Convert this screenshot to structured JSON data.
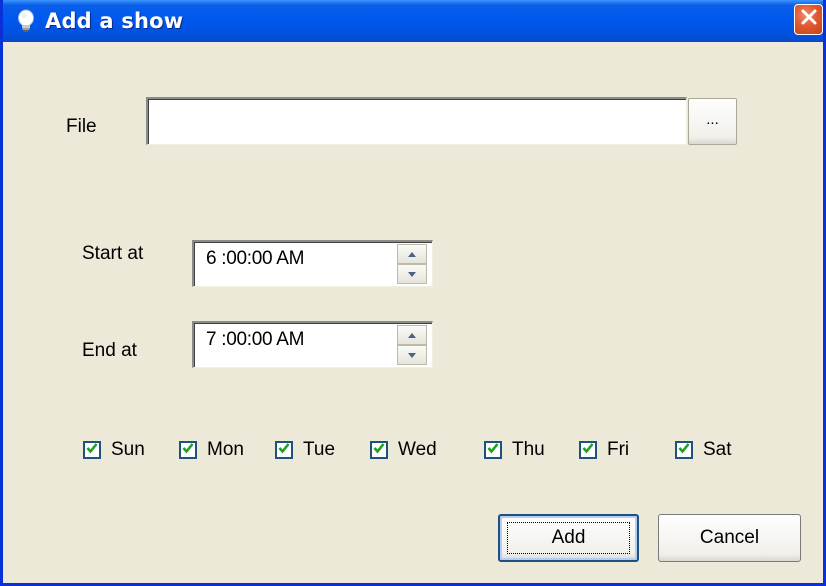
{
  "window": {
    "title": "Add a show",
    "title_icon": "lightbulb-icon",
    "close_icon": "close-icon"
  },
  "file": {
    "label": "File",
    "value": "",
    "browse_label": "..."
  },
  "start": {
    "label": "Start at",
    "value": "6 :00:00 AM"
  },
  "end": {
    "label": "End at",
    "value": "7 :00:00 AM"
  },
  "days": [
    {
      "label": "Sun",
      "checked": true
    },
    {
      "label": "Mon",
      "checked": true
    },
    {
      "label": "Tue",
      "checked": true
    },
    {
      "label": "Wed",
      "checked": true
    },
    {
      "label": "Thu",
      "checked": true
    },
    {
      "label": "Fri",
      "checked": true
    },
    {
      "label": "Sat",
      "checked": true
    }
  ],
  "buttons": {
    "add": "Add",
    "cancel": "Cancel"
  },
  "colors": {
    "titlebar": "#0058EE",
    "dialog_bg": "#ECE9D8",
    "close_button": "#E05A30",
    "checkbox_border": "#1C5180"
  }
}
